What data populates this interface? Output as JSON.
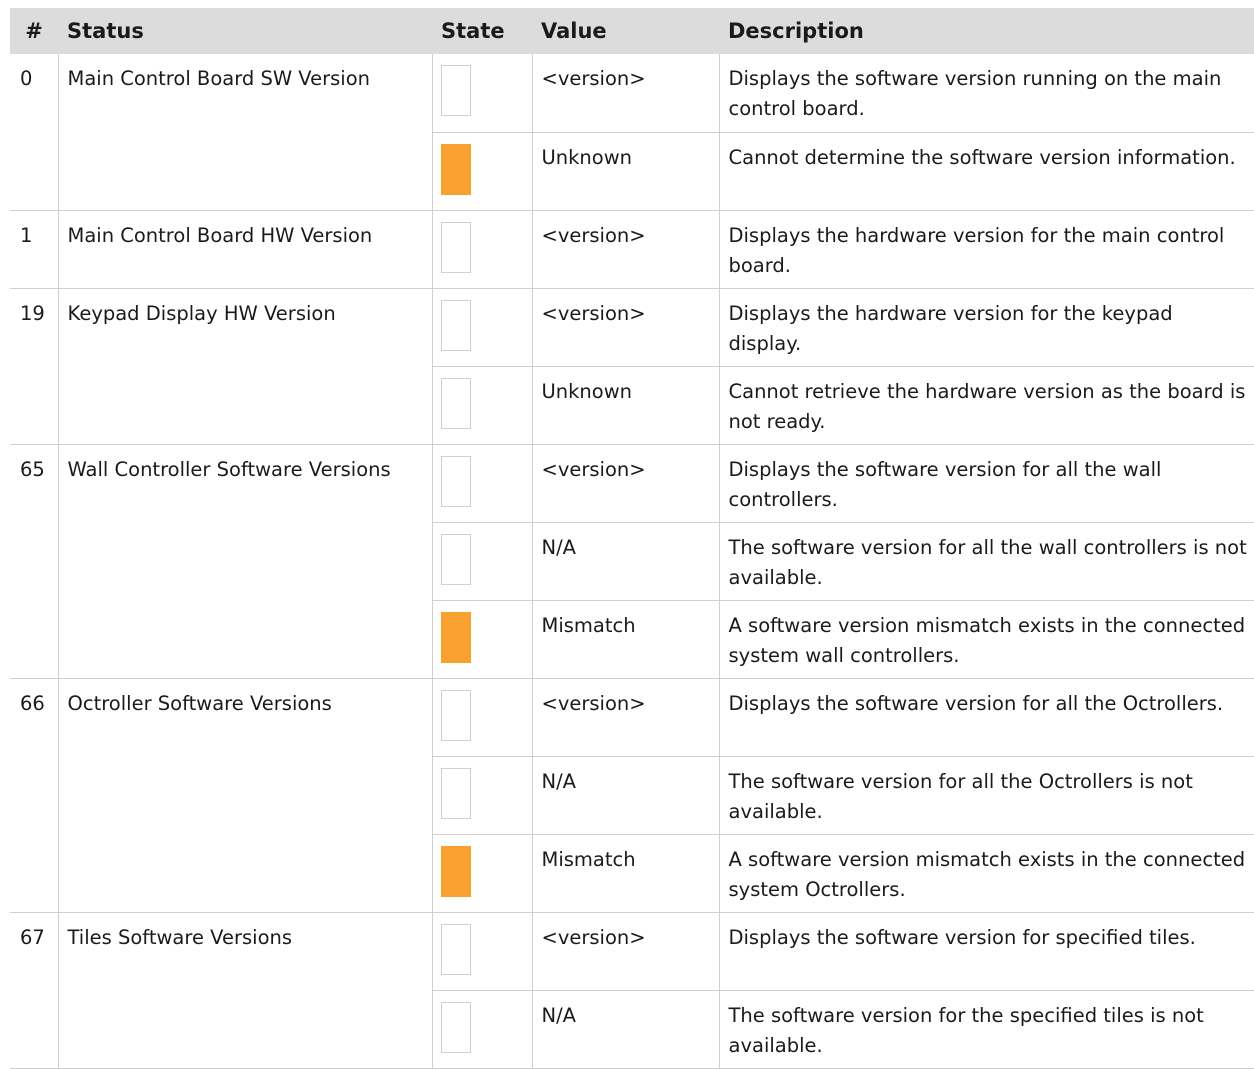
{
  "headers": {
    "num": "#",
    "status": "Status",
    "state": "State",
    "value": "Value",
    "description": "Description"
  },
  "colors": {
    "warning": "#f9a12e",
    "header_bg": "#dcdcdc",
    "none": "#ffffff"
  },
  "rows": [
    {
      "num": "0",
      "status": "Main Control Board SW Version",
      "entries": [
        {
          "state": "none",
          "value": "<version>",
          "description": "Displays the software version running on the main control board."
        },
        {
          "state": "warning",
          "value": "Unknown",
          "description": "Cannot determine the software version information."
        }
      ]
    },
    {
      "num": "1",
      "status": "Main Control Board HW Version",
      "entries": [
        {
          "state": "none",
          "value": "<version>",
          "description": "Displays the hardware version for the main control board."
        }
      ]
    },
    {
      "num": "19",
      "status": "Keypad Display HW Version",
      "entries": [
        {
          "state": "none",
          "value": "<version>",
          "description": "Displays the hardware version for the keypad display."
        },
        {
          "state": "none",
          "value": "Unknown",
          "description": "Cannot retrieve the hardware version as the board is not ready."
        }
      ]
    },
    {
      "num": "65",
      "status": "Wall Controller Software Versions",
      "entries": [
        {
          "state": "none",
          "value": "<version>",
          "description": "Displays the software version for all the wall controllers."
        },
        {
          "state": "none",
          "value": "N/A",
          "description": "The software version for all the wall controllers is not available."
        },
        {
          "state": "warning",
          "value": "Mismatch",
          "description": "A software version mismatch exists in the connected system wall controllers."
        }
      ]
    },
    {
      "num": "66",
      "status": "Octroller Software Versions",
      "entries": [
        {
          "state": "none",
          "value": "<version>",
          "description": "Displays the software version for all the Octrollers."
        },
        {
          "state": "none",
          "value": "N/A",
          "description": "The software version for all the Octrollers is not available."
        },
        {
          "state": "warning",
          "value": "Mismatch",
          "description": "A software version mismatch exists in the connected system Octrollers."
        }
      ]
    },
    {
      "num": "67",
      "status": "Tiles Software Versions",
      "entries": [
        {
          "state": "none",
          "value": "<version>",
          "description": "Displays the software version for specified tiles."
        },
        {
          "state": "none",
          "value": "N/A",
          "description": "The software version for the specified tiles is not available."
        }
      ]
    }
  ]
}
